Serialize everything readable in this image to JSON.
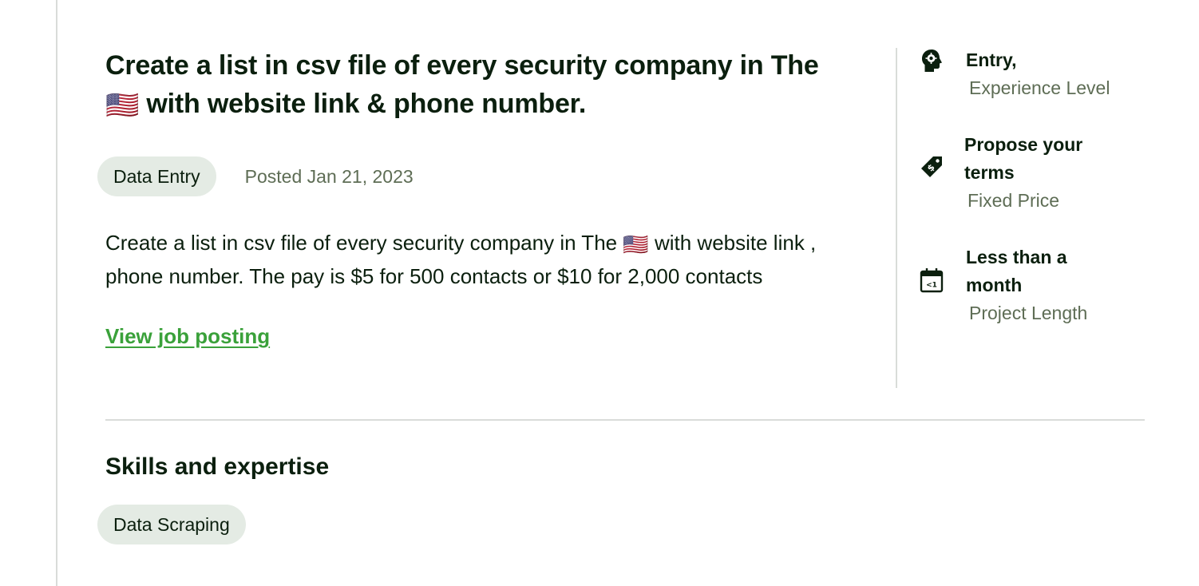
{
  "job": {
    "title_part1": "Create a list in csv file of every security company in The",
    "title_flag": "🇺🇸",
    "title_part2": "with website link & phone number.",
    "category": "Data Entry",
    "posted": "Posted Jan 21, 2023",
    "description_part1": "Create a list in csv file of every security company in The",
    "description_flag": "🇺🇸",
    "description_part2": "with website link , phone number. The pay is $5 for 500 contacts or $10 for 2,000 contacts",
    "view_link": "View job posting"
  },
  "sidebar": {
    "items": [
      {
        "icon": "experience-head-icon",
        "label": "Entry,",
        "sub": "Experience Level"
      },
      {
        "icon": "price-tag-icon",
        "label": "Propose your terms",
        "sub": "Fixed Price"
      },
      {
        "icon": "calendar-icon",
        "label": "Less than a month",
        "sub": "Project Length"
      }
    ]
  },
  "skills": {
    "title": "Skills and expertise",
    "items": [
      "Data Scraping"
    ]
  },
  "colors": {
    "text": "#0b1f0e",
    "muted": "#5e6d55",
    "link": "#3aa13a",
    "chip_bg": "#e4ebe4",
    "rule": "#d9dcd9"
  }
}
